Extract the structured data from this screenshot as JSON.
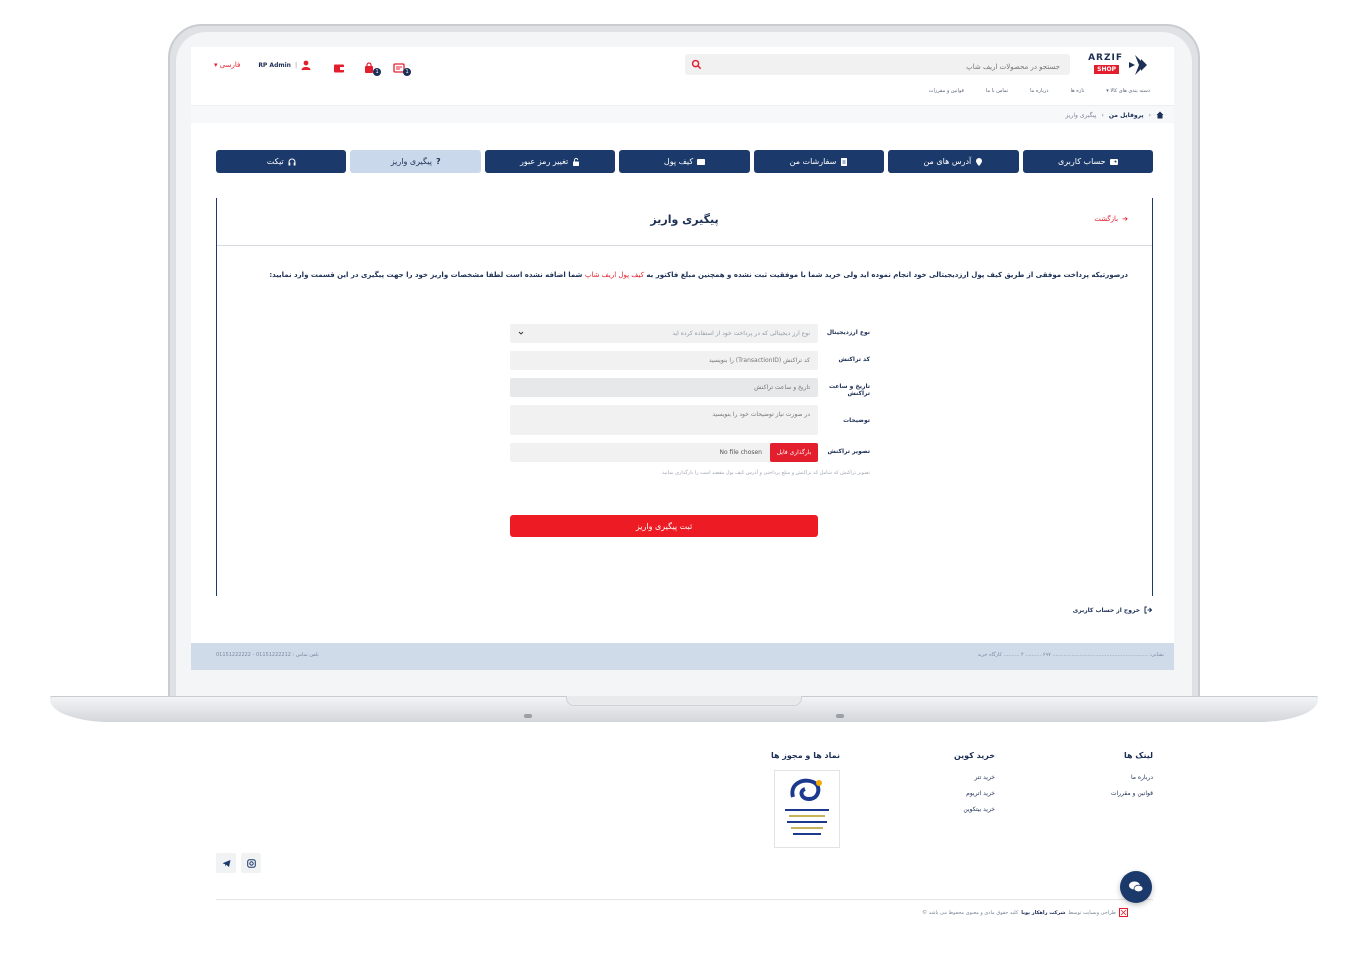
{
  "header": {
    "logo_name": "ARZIF",
    "logo_sub": "SHOP",
    "search_placeholder": "جستجو در محصولات اریف شاپ",
    "language": "فارسی",
    "user_name": "RP Admin",
    "cart_count": "1",
    "compare_count": "1"
  },
  "nav": {
    "items": [
      "دسته بندی های کالا",
      "تازه ها",
      "درباره ما",
      "تماس با ما",
      "قوانین و مقررات"
    ]
  },
  "breadcrumb": {
    "profile": "پروفایل من",
    "current": "پیگیری واریز"
  },
  "tabs": [
    {
      "label": "حساب کاربری"
    },
    {
      "label": "آدرس های من"
    },
    {
      "label": "سفارشات من"
    },
    {
      "label": "کیف پول"
    },
    {
      "label": "تغییر رمز عبور"
    },
    {
      "label": "پیگیری واریز"
    },
    {
      "label": "تیکت"
    }
  ],
  "panel": {
    "back": "بازگشت",
    "title": "پیگیری واریز",
    "intro_1": "درصورتیکه پرداخت موفقی از طریق کیف پول ارزدیجیتالی خود انجام نموده اید ولی خرید شما با موفقیت ثبت نشده و همچنین مبلغ فاکتور به",
    "intro_link": "کیف پول اریف شاپ",
    "intro_2": "شما اضافه نشده است لطفا مشخصات واریز خود را جهت پیگیری در این قسمت وارد نمایید:"
  },
  "form": {
    "currency_label": "نوع ارزدیجیتال",
    "currency_value": "نوع ارز دیجیتالی که در پرداخت خود از استفاده کرده اید",
    "txid_label": "کد تراکنش",
    "txid_placeholder": "کد تراکنش (TransactionID) را بنویسید",
    "datetime_label": "تاریخ و ساعت تراکنش",
    "datetime_placeholder": "تاریخ و ساعت تراکنش",
    "desc_label": "توضیحات",
    "desc_placeholder": "در صورت نیاز توضیحات خود را بنویسید",
    "image_label": "تصویر تراکنش",
    "file_button": "بارگذاری فایل",
    "file_status": "No file chosen",
    "hint": "تصویر تراکنش که شامل کد تراکنش و مبلغ پرداختی و آدرس کیف پول مقصد است را بارگذاری نمایید",
    "submit": "ثبت پیگیری واریز"
  },
  "logout": "خروج از حساب کاربری",
  "footstrip": {
    "address": "نشانی: ............................................................ ۶۹۷ .......... ۴ .......... کارگاه خرید",
    "phone": "تلفن تماس : 01151222212 - 01151222222"
  },
  "footer": {
    "links_title": "لینک ها",
    "links": [
      "درباره ما",
      "قوانین و مقررات"
    ],
    "coins_title": "خرید کوین",
    "coins": [
      "خرید تتر",
      "خرید اتریوم",
      "خرید بیتکوین"
    ],
    "trust_title": "نماد ها و مجوز ها",
    "company": "شرکت راهکار پویا",
    "copyright": "طراحی وبسایت توسط",
    "rights": "کلیه حقوق مادی و معنوی محفوظ می باشد ©"
  },
  "colors": {
    "navy": "#1b3a6b",
    "red": "#ed1c24",
    "active_tab": "#c9d8ea"
  }
}
